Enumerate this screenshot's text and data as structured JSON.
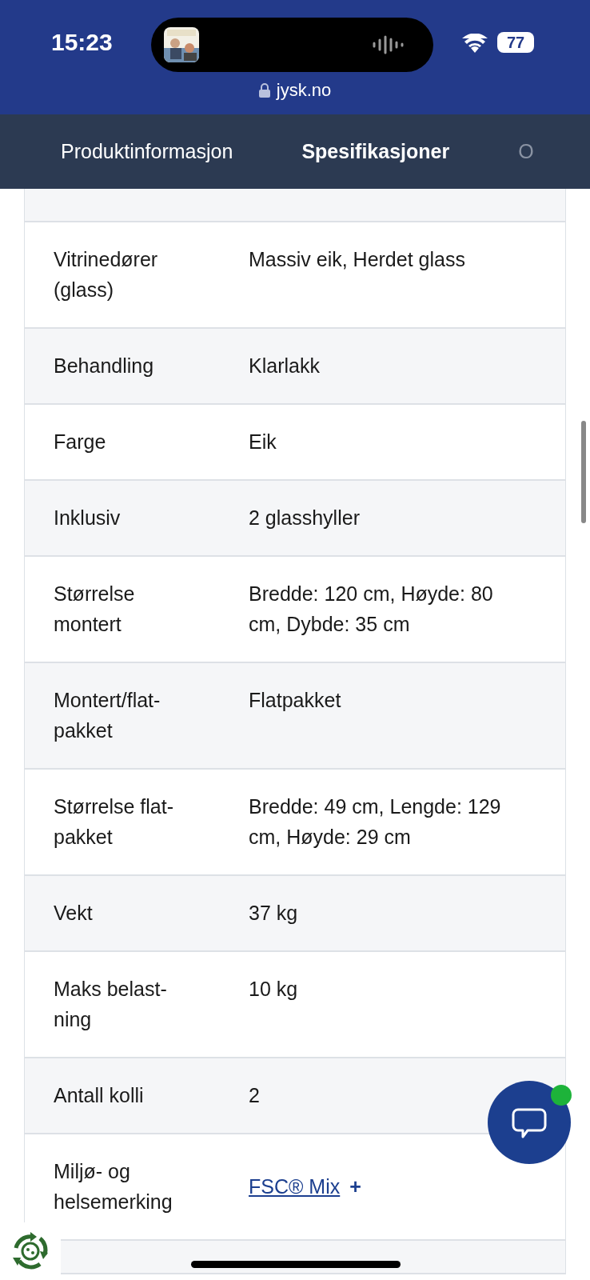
{
  "status_bar": {
    "time": "15:23",
    "battery": "77"
  },
  "address_bar": {
    "url": "jysk.no"
  },
  "tabs": [
    {
      "label": "Produktinformasjon",
      "selected": false
    },
    {
      "label": "Spesifikasjoner",
      "selected": true
    },
    {
      "label": "O",
      "selected": false
    }
  ],
  "spec_rows": [
    {
      "kind": "text",
      "label": "Vitrinedører (glass)",
      "value": "Massiv eik, Herdet glass"
    },
    {
      "kind": "text",
      "label": "Behandling",
      "value": "Klarlakk"
    },
    {
      "kind": "text",
      "label": "Farge",
      "value": "Eik"
    },
    {
      "kind": "text",
      "label": "Inklusiv",
      "value": "2 glasshyller"
    },
    {
      "kind": "text",
      "label": "Størrelse montert",
      "value": "Bredde: 120 cm, Høyde: 80 cm, Dybde: 35 cm"
    },
    {
      "kind": "text",
      "label": "Montert/flat-pakket",
      "value": "Flatpakket"
    },
    {
      "kind": "text",
      "label": "Størrelse flat-pakket",
      "value": "Bredde: 49 cm, Lengde: 129 cm, Høyde: 29 cm"
    },
    {
      "kind": "text",
      "label": "Vekt",
      "value": "37 kg"
    },
    {
      "kind": "text",
      "label": "Maks belast-ning",
      "value": "10 kg"
    },
    {
      "kind": "text",
      "label": "Antall kolli",
      "value": "2"
    },
    {
      "kind": "link",
      "label": "Miljø- og helsemerking",
      "value": "FSC® Mix",
      "suffix": "+"
    }
  ],
  "chat_button": {
    "online": true
  }
}
